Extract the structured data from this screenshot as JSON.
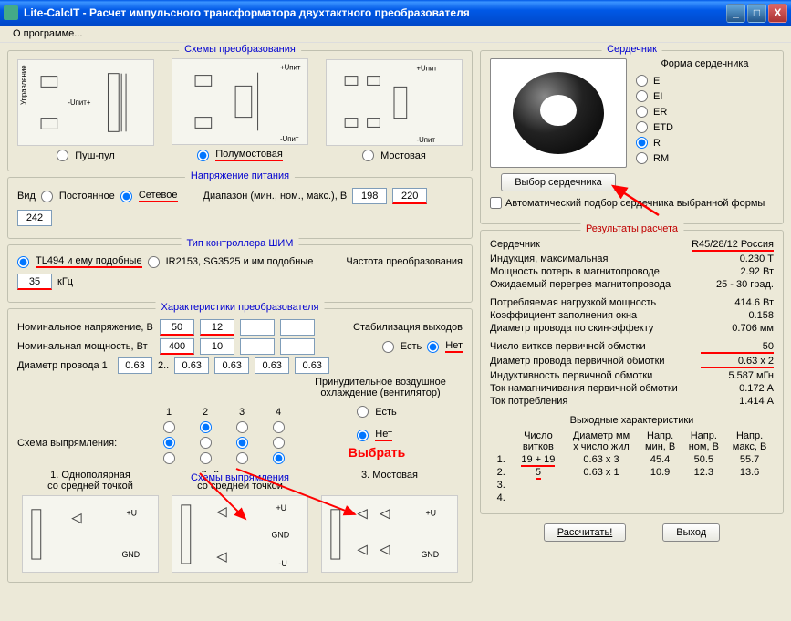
{
  "window": {
    "title": "Lite-CalcIT - Расчет импульсного трансформатора двухтактного преобразователя"
  },
  "menu": {
    "about": "О программе..."
  },
  "topology": {
    "title": "Схемы преобразования",
    "push_pull": "Пуш-пул",
    "half_bridge": "Полумостовая",
    "full_bridge": "Мостовая",
    "label_control": "Управление",
    "label_upit_plus": "+Uпит",
    "label_upit_minus": "-Uпит",
    "label_upit_pm": "-Uпит+"
  },
  "supply": {
    "title": "Напряжение питания",
    "kind": "Вид",
    "dc": "Постоянное",
    "ac": "Сетевое",
    "range": "Диапазон (мин., ном., макс.), В",
    "min": "198",
    "nom": "220",
    "max": "242"
  },
  "pwm": {
    "title": "Тип контроллера ШИМ",
    "tl494": "TL494 и ему подобные",
    "ir2153": "IR2153, SG3525 и им подобные",
    "freq_label": "Частота преобразования",
    "freq": "35",
    "freq_unit": "кГц"
  },
  "conv": {
    "title": "Характеристики преобразователя",
    "nom_voltage": "Номинальное напряжение, В",
    "v1": "50",
    "v2": "12",
    "v3": "",
    "v4": "",
    "nom_power": "Номинальная мощность, Вт",
    "p1": "400",
    "p2": "10",
    "p3": "",
    "p4": "",
    "wire_dia": "Диаметр провода 1",
    "d1": "0.63",
    "d2sep": "2..",
    "d2": "0.63",
    "d3": "0.63",
    "d4": "0.63",
    "d5": "0.63",
    "stab": "Стабилизация выходов",
    "yes": "Есть",
    "no": "Нет",
    "fan": "Принудительное воздушное охлаждение (вентилятор)",
    "rect_scheme": "Схема выпрямления:",
    "col1": "1",
    "col2": "2",
    "col3": "3",
    "col4": "4",
    "rect_title": "Схемы выпрямления",
    "rect1_a": "1. Однополярная",
    "rect1_b": "со средней точкой",
    "rect2_a": "2. Двухполярная",
    "rect2_b": "со средней точкой",
    "rect3_a": "3. Мостовая"
  },
  "annot": {
    "select": "Выбрать"
  },
  "core": {
    "title": "Сердечник",
    "shape_title": "Форма сердечника",
    "E": "E",
    "EI": "EI",
    "ER": "ER",
    "ETD": "ETD",
    "R": "R",
    "RM": "RM",
    "choose_btn": "Выбор сердечника",
    "auto": "Автоматический подбор сердечника выбранной формы"
  },
  "results": {
    "title": "Результаты расчета",
    "core_label": "Сердечник",
    "core_val": "R45/28/12 Россия",
    "bmax_label": "Индукция, максимальная",
    "bmax_val": "0.230 Т",
    "ploss_label": "Мощность потерь в магнитопроводе",
    "ploss_val": "2.92 Вт",
    "temp_label": "Ожидаемый перегрев магнитопровода",
    "temp_val": "25 - 30 град.",
    "load_label": "Потребляемая нагрузкой мощность",
    "load_val": "414.6 Вт",
    "fill_label": "Коэффициент заполнения окна",
    "fill_val": "0.158",
    "skin_label": "Диаметр провода по скин-эффекту",
    "skin_val": "0.706 мм",
    "nturns_label": "Число витков первичной обмотки",
    "nturns_val": "50",
    "pdia_label": "Диаметр провода первичной обмотки",
    "pdia_val": "0.63 x 2",
    "lind_label": "Индуктивность первичной обмотки",
    "lind_val": "5.587 мГн",
    "imag_label": "Ток намагничивания первичной обмотки",
    "imag_val": "0.172 А",
    "icons_label": "Ток потребления",
    "icons_val": "1.414 А",
    "out_title": "Выходные характеристики",
    "h1a": "Число",
    "h1b": "витков",
    "h2a": "Диаметр мм",
    "h2b": "x число жил",
    "h3a": "Напр.",
    "h3b": "мин, В",
    "h4a": "Напр.",
    "h4b": "ном, В",
    "h5a": "Напр.",
    "h5b": "макс, В",
    "r1_n": "1.",
    "r1_turns": "19 + 19",
    "r1_dia": "0.63 x 3",
    "r1_min": "45.4",
    "r1_nom": "50.5",
    "r1_max": "55.7",
    "r2_n": "2.",
    "r2_turns": "5",
    "r2_dia": "0.63 x 1",
    "r2_min": "10.9",
    "r2_nom": "12.3",
    "r2_max": "13.6",
    "r3_n": "3.",
    "r4_n": "4."
  },
  "buttons": {
    "calc": "Рассчитать!",
    "exit": "Выход"
  }
}
